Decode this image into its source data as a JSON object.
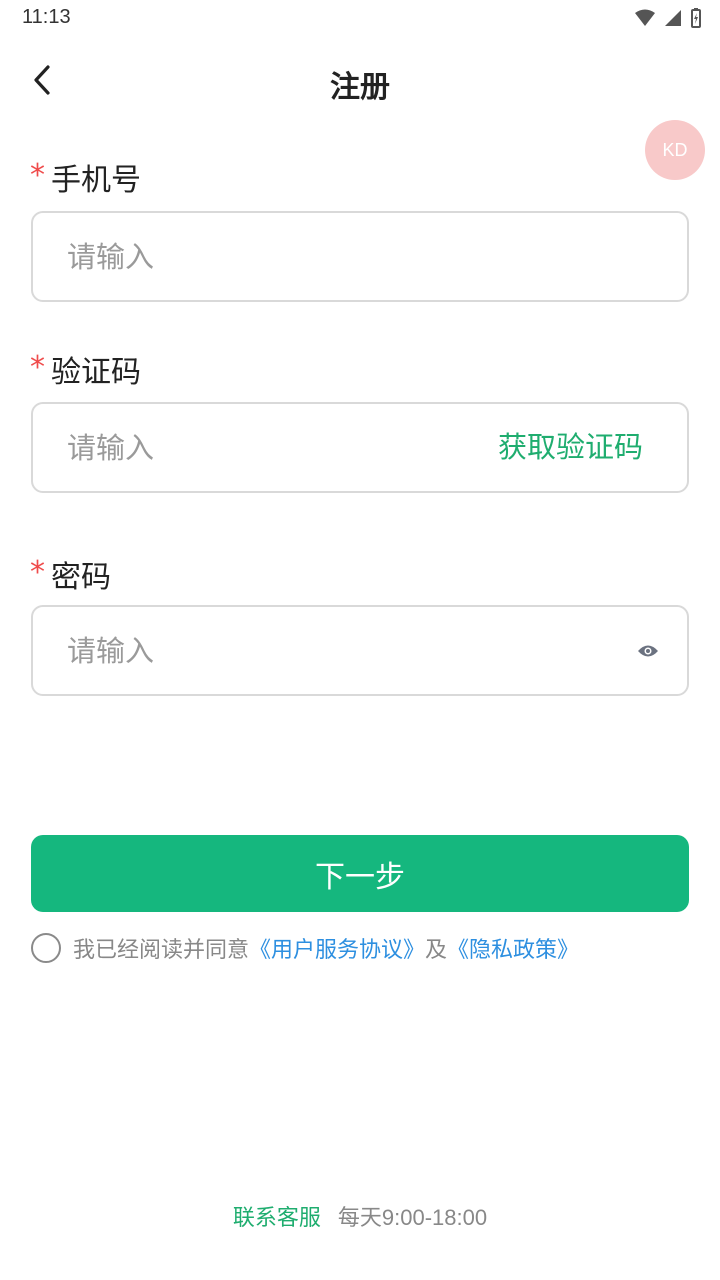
{
  "status_bar": {
    "time": "11:13"
  },
  "header": {
    "title": "注册"
  },
  "float_badge": "KD",
  "form": {
    "required_mark": "*",
    "phone": {
      "label": "手机号",
      "placeholder": "请输入"
    },
    "code": {
      "label": "验证码",
      "placeholder": "请输入",
      "get_code_label": "获取验证码"
    },
    "password": {
      "label": "密码",
      "placeholder": "请输入"
    }
  },
  "next_button": {
    "label": "下一步"
  },
  "agreement": {
    "prefix": "我已经阅读并同意",
    "user_agreement": "《用户服务协议》",
    "conjunction": "及",
    "privacy_policy": "《隐私政策》"
  },
  "footer": {
    "contact_label": "联系客服",
    "hours": "每天9:00-18:00"
  },
  "colors": {
    "primary_green": "#15b77e",
    "link_blue": "#2d8fe0",
    "required_red": "#ef4b4b"
  }
}
